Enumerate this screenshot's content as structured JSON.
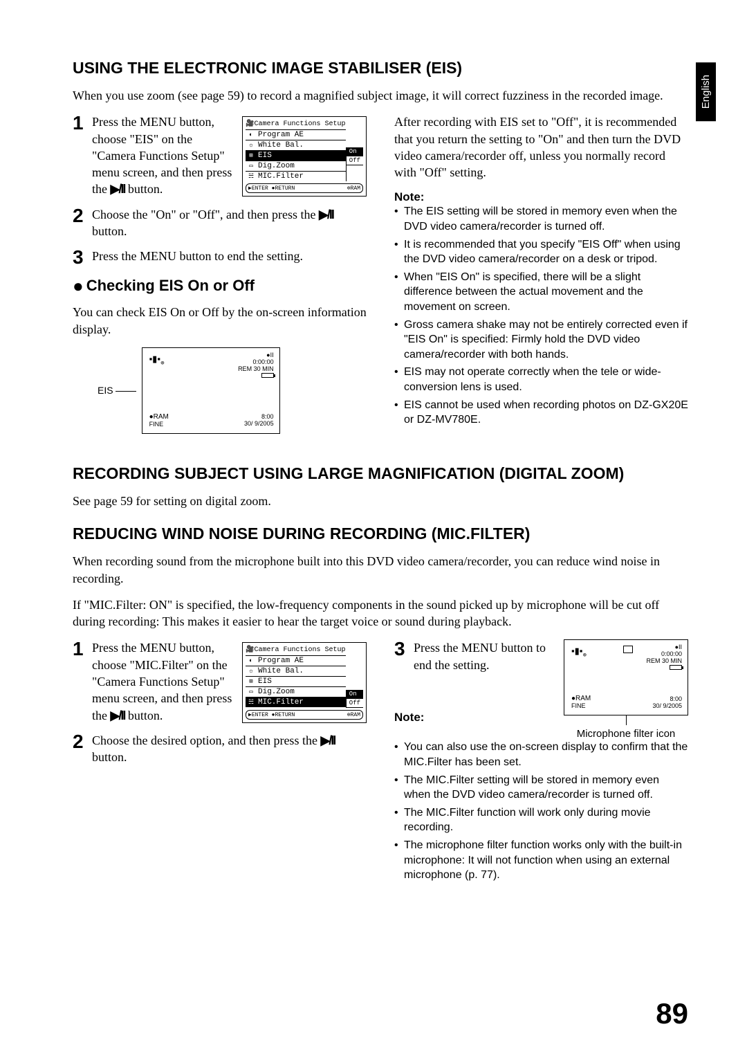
{
  "lang_tab": "English",
  "eis": {
    "heading": "USING THE ELECTRONIC IMAGE STABILISER (EIS)",
    "intro": "When you use zoom (see page 59) to record a magnified subject image, it will correct fuzziness in the recorded image.",
    "step1": "Press the MENU button, choose \"EIS\" on the \"Camera Functions Setup\" menu screen, and then press the ",
    "step1_after": " button.",
    "step2": "Choose the \"On\" or \"Off\", and then press the ",
    "step2_after": " button.",
    "step3": "Press the MENU button to end the setting.",
    "check_heading": "Checking EIS On or Off",
    "check_text": "You can check EIS On or Off by the on-screen information display.",
    "osd_label": "EIS",
    "right_para": "After recording with EIS set to \"Off\", it is recommended that you return the setting to \"On\" and then turn the DVD video camera/recorder off, unless you normally record with \"Off\" setting.",
    "note_head": "Note:",
    "notes": [
      "The EIS setting will be stored in memory even when the DVD video camera/recorder is turned off.",
      "It is recommended that you specify \"EIS Off\" when using the DVD video camera/recorder on a desk or tripod.",
      "When \"EIS On\" is specified, there will be a slight difference between the actual movement and the movement on screen.",
      "Gross camera shake may not be entirely corrected even if \"EIS On\" is specified: Firmly hold the DVD video camera/recorder with both hands.",
      "EIS may not operate correctly when the tele or wide-conversion lens is used.",
      "EIS cannot be used when recording photos on DZ-GX20E or DZ-MV780E."
    ]
  },
  "zoom": {
    "heading": "RECORDING SUBJECT USING LARGE MAGNIFICATION (DIGITAL ZOOM)",
    "text": "See page 59 for setting on digital zoom."
  },
  "mic": {
    "heading": "REDUCING WIND NOISE DURING RECORDING (MIC.FILTER)",
    "intro1": "When recording sound from the microphone built into this DVD video camera/recorder, you can reduce wind noise in recording.",
    "intro2": "If \"MIC.Filter: ON\" is specified, the low-frequency components in the sound picked up by microphone will be cut off during recording: This makes it easier to hear the target voice or sound during playback.",
    "step1": "Press the MENU button, choose \"MIC.Filter\" on the \"Camera Functions Setup\" menu screen, and then press the ",
    "step1_after": " button.",
    "step2": "Choose the desired option, and then press the ",
    "step2_after": " button.",
    "step3": "Press the MENU button to end the setting.",
    "note_head": "Note:",
    "osd_caption": "Microphone filter icon",
    "notes": [
      "You can also use the on-screen display to confirm that the MIC.Filter has been set.",
      "The MIC.Filter setting will be stored in memory even when the DVD video camera/recorder is turned off.",
      "The MIC.Filter function will work only during movie recording.",
      "The microphone filter function works only with the built-in microphone: It will not function when using an external microphone (p. 77)."
    ]
  },
  "menu": {
    "title": "Camera Functions Setup",
    "items": [
      "Program AE",
      "White Bal.",
      "EIS",
      "Dig.Zoom",
      "MIC.Filter"
    ],
    "opt_on": "On",
    "opt_off": "Off",
    "footer_enter": "ENTER",
    "footer_return": "RETURN",
    "footer_ram": "RAM"
  },
  "osd": {
    "rec": "●II",
    "time": "0:00:00",
    "rem": "REM 30 MIN",
    "ram": "●RAM",
    "fine": "FINE",
    "clock": "8:00",
    "date": "30/ 9/2005"
  },
  "play_pause": "▶/II",
  "page_number": "89"
}
